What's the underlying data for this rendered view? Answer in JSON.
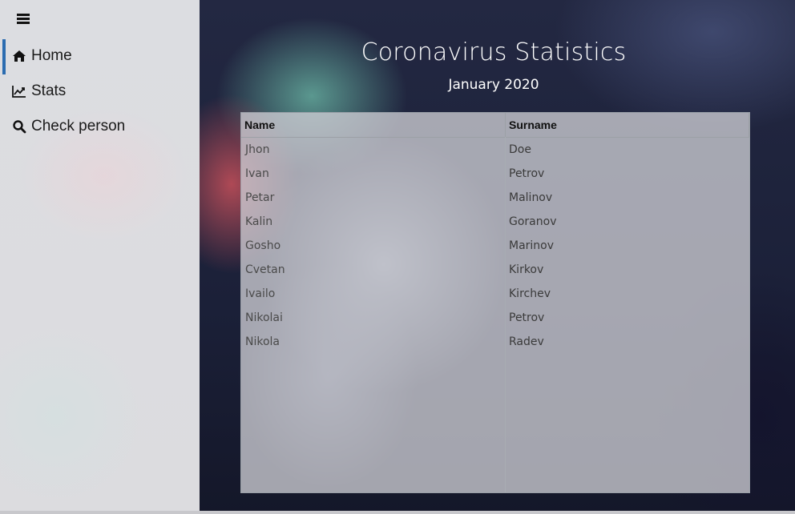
{
  "sidebar": {
    "menu_icon": "hamburger-icon",
    "items": [
      {
        "label": "Home",
        "icon": "home-icon",
        "active": true
      },
      {
        "label": "Stats",
        "icon": "line-chart-icon",
        "active": false
      },
      {
        "label": "Check person",
        "icon": "search-icon",
        "active": false
      }
    ]
  },
  "header": {
    "title": "Coronavirus Statistics",
    "subtitle": "January 2020"
  },
  "table": {
    "columns": [
      "Name",
      "Surname"
    ],
    "rows": [
      {
        "name": "Jhon",
        "surname": "Doe"
      },
      {
        "name": "Ivan",
        "surname": "Petrov"
      },
      {
        "name": "Petar",
        "surname": "Malinov"
      },
      {
        "name": "Kalin",
        "surname": "Goranov"
      },
      {
        "name": "Gosho",
        "surname": "Marinov"
      },
      {
        "name": "Cvetan",
        "surname": "Kirkov"
      },
      {
        "name": "Ivailo",
        "surname": "Kirchev"
      },
      {
        "name": "Nikolai",
        "surname": "Petrov"
      },
      {
        "name": "Nikola",
        "surname": "Radev"
      }
    ]
  },
  "colors": {
    "accent": "#2b6cb0"
  }
}
